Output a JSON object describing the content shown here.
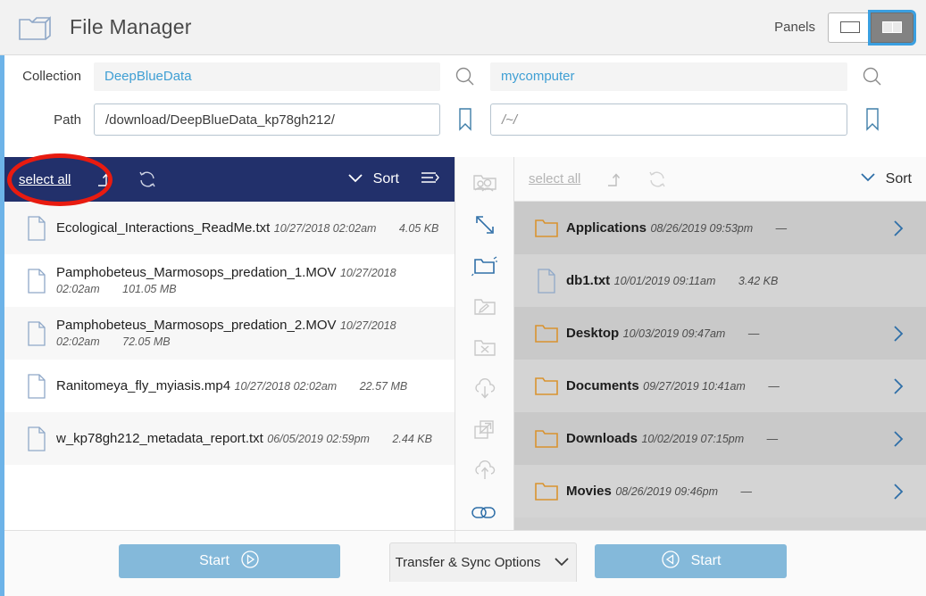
{
  "header": {
    "title": "File Manager",
    "logo_icon": "folder-icon",
    "panels_label": "Panels",
    "panels": [
      {
        "name": "single-panel",
        "icon": "single-pane-icon",
        "selected": false
      },
      {
        "name": "dual-panel",
        "icon": "dual-pane-icon",
        "selected": true
      }
    ]
  },
  "left_panel": {
    "collection_label": "Collection",
    "collection_value": "DeepBlueData",
    "path_label": "Path",
    "path_value": "/download/DeepBlueData_kp78gh212/",
    "search_icon": "search-icon",
    "bookmark_icon": "bookmark-icon",
    "toolbar": {
      "select_all": "select all",
      "up_icon": "parent-folder-icon",
      "refresh_icon": "refresh-icon",
      "sort_label": "Sort",
      "chevron_icon": "chevron-down-icon",
      "list_icon": "list-options-icon"
    },
    "rows": [
      {
        "name": "Ecological_Interactions_ReadMe.txt",
        "date": "10/27/2018 02:02am",
        "size": "4.05 KB",
        "type": "file"
      },
      {
        "name": "Pamphobeteus_Marmosops_predation_1.MOV",
        "date": "10/27/2018 02:02am",
        "size": "101.05 MB",
        "type": "file"
      },
      {
        "name": "Pamphobeteus_Marmosops_predation_2.MOV",
        "date": "10/27/2018 02:02am",
        "size": "72.05 MB",
        "type": "file"
      },
      {
        "name": "Ranitomeya_fly_myiasis.mp4",
        "date": "10/27/2018 02:02am",
        "size": "22.57 MB",
        "type": "file"
      },
      {
        "name": "w_kp78gh212_metadata_report.txt",
        "date": "06/05/2019 02:59pm",
        "size": "2.44 KB",
        "type": "file"
      }
    ],
    "start_label": "Start",
    "start_icon": "play-right-icon"
  },
  "center_tools": [
    {
      "name": "share-folder-icon",
      "enabled": false
    },
    {
      "name": "resize-arrows-icon",
      "enabled": true
    },
    {
      "name": "new-folder-icon",
      "enabled": true
    },
    {
      "name": "edit-folder-icon",
      "enabled": false
    },
    {
      "name": "delete-folder-icon",
      "enabled": false
    },
    {
      "name": "cloud-download-icon",
      "enabled": false
    },
    {
      "name": "open-external-icon",
      "enabled": false
    },
    {
      "name": "cloud-upload-icon",
      "enabled": false
    },
    {
      "name": "link-toggle-icon",
      "enabled": true
    }
  ],
  "right_panel": {
    "collection_value": "mycomputer",
    "path_value": "/~/",
    "search_icon": "search-icon",
    "bookmark_icon": "bookmark-icon",
    "toolbar": {
      "select_all": "select all",
      "up_icon": "parent-folder-icon",
      "refresh_icon": "refresh-icon",
      "sort_label": "Sort",
      "chevron_icon": "chevron-down-icon"
    },
    "rows": [
      {
        "name": "Applications",
        "date": "08/26/2019 09:53pm",
        "size": "—",
        "type": "folder"
      },
      {
        "name": "db1.txt",
        "date": "10/01/2019 09:11am",
        "size": "3.42 KB",
        "type": "file"
      },
      {
        "name": "Desktop",
        "date": "10/03/2019 09:47am",
        "size": "—",
        "type": "folder"
      },
      {
        "name": "Documents",
        "date": "09/27/2019 10:41am",
        "size": "—",
        "type": "folder"
      },
      {
        "name": "Downloads",
        "date": "10/02/2019 07:15pm",
        "size": "—",
        "type": "folder"
      },
      {
        "name": "Movies",
        "date": "08/26/2019 09:46pm",
        "size": "—",
        "type": "folder"
      }
    ],
    "start_label": "Start",
    "start_icon": "play-left-icon"
  },
  "footer": {
    "transfer_options_label": "Transfer & Sync Options",
    "transfer_chevron": "chevron-down-icon"
  },
  "annotation": {
    "shape": "red-ellipse",
    "color": "#e81b10",
    "target": "select-all-link"
  },
  "colors": {
    "toolbar_dark": "#22306b",
    "accent_blue": "#3f9fd4",
    "edge_stripe": "#6db3e8",
    "folder_orange": "#d9932f",
    "start_button": "#84b9da",
    "annotation_red": "#e81b10"
  }
}
